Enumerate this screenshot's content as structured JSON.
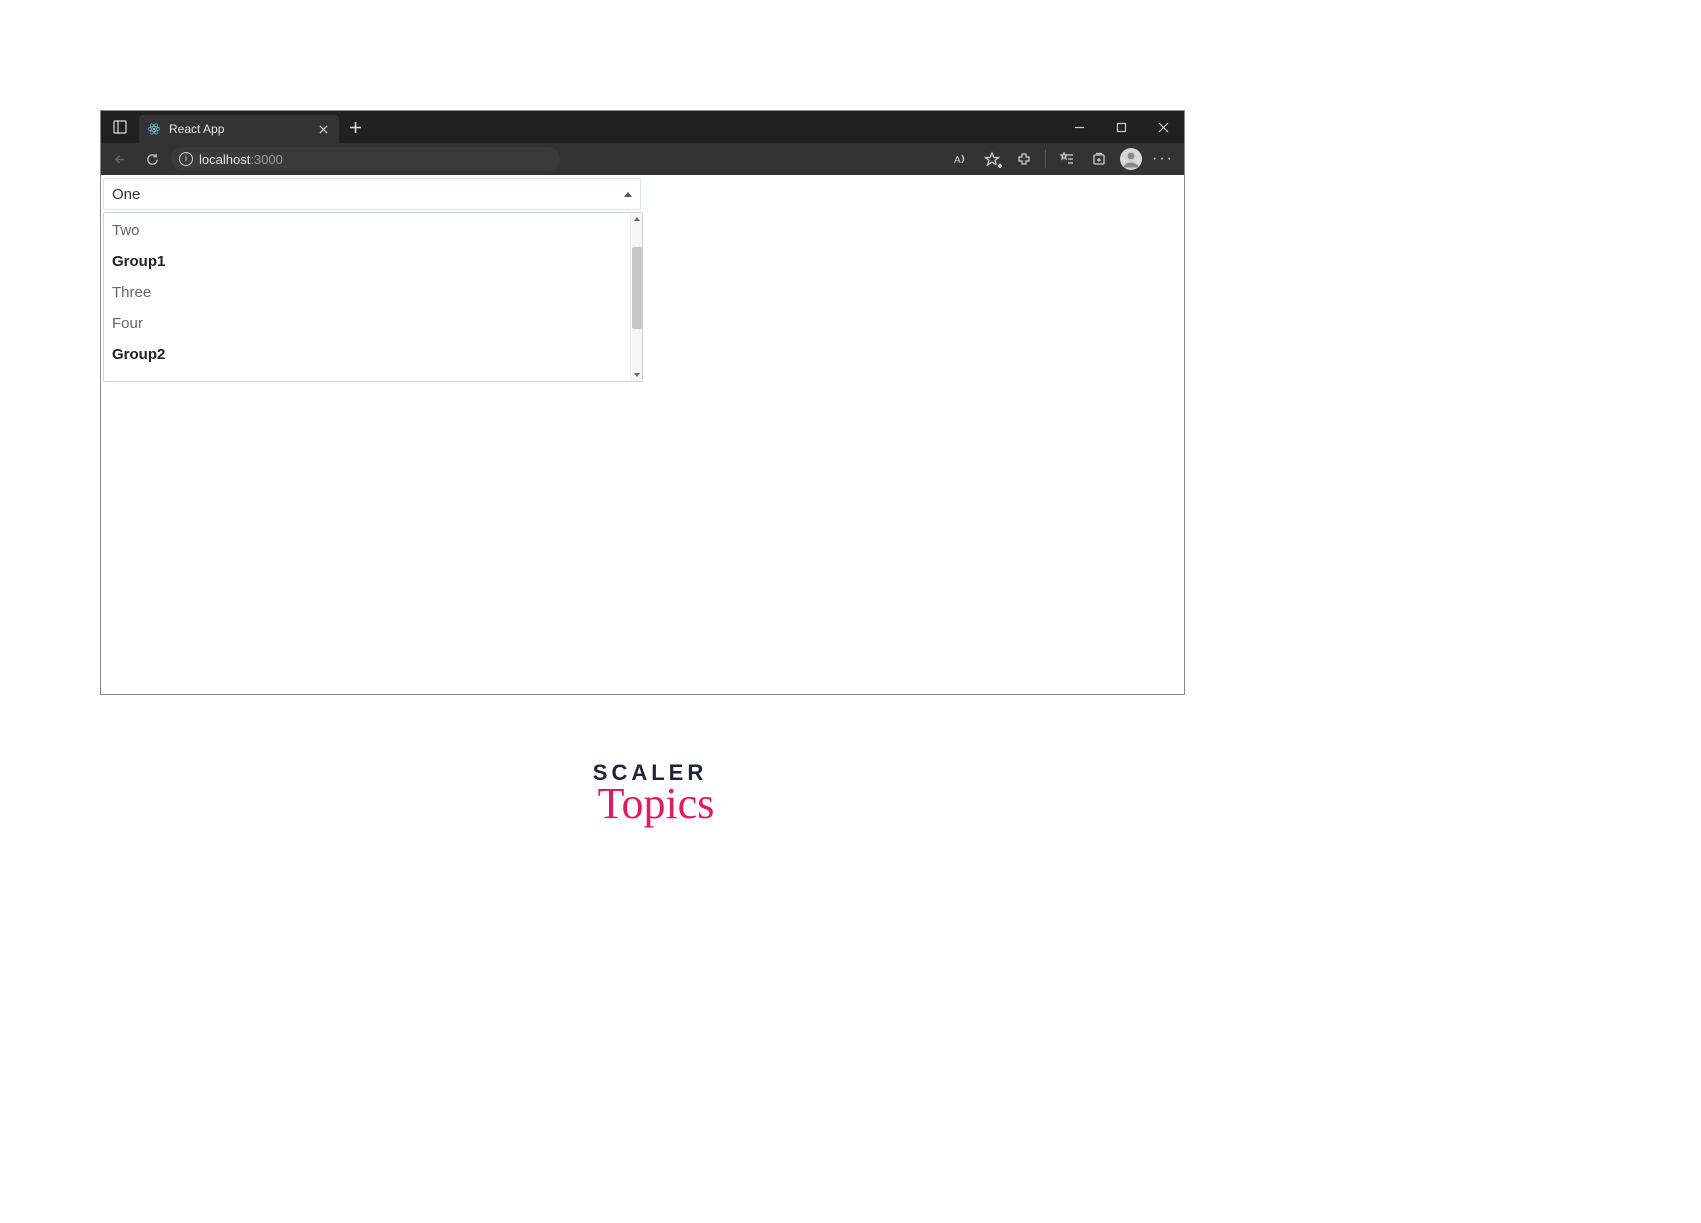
{
  "browser": {
    "tab": {
      "title": "React App"
    },
    "address": {
      "host": "localhost",
      "port": ":3000"
    }
  },
  "select": {
    "selected": "One",
    "options": {
      "opt_two": "Two",
      "group1": "Group1",
      "opt_three": "Three",
      "opt_four": "Four",
      "group2": "Group2"
    }
  },
  "branding": {
    "top": "SCALER",
    "bottom": "Topics"
  }
}
